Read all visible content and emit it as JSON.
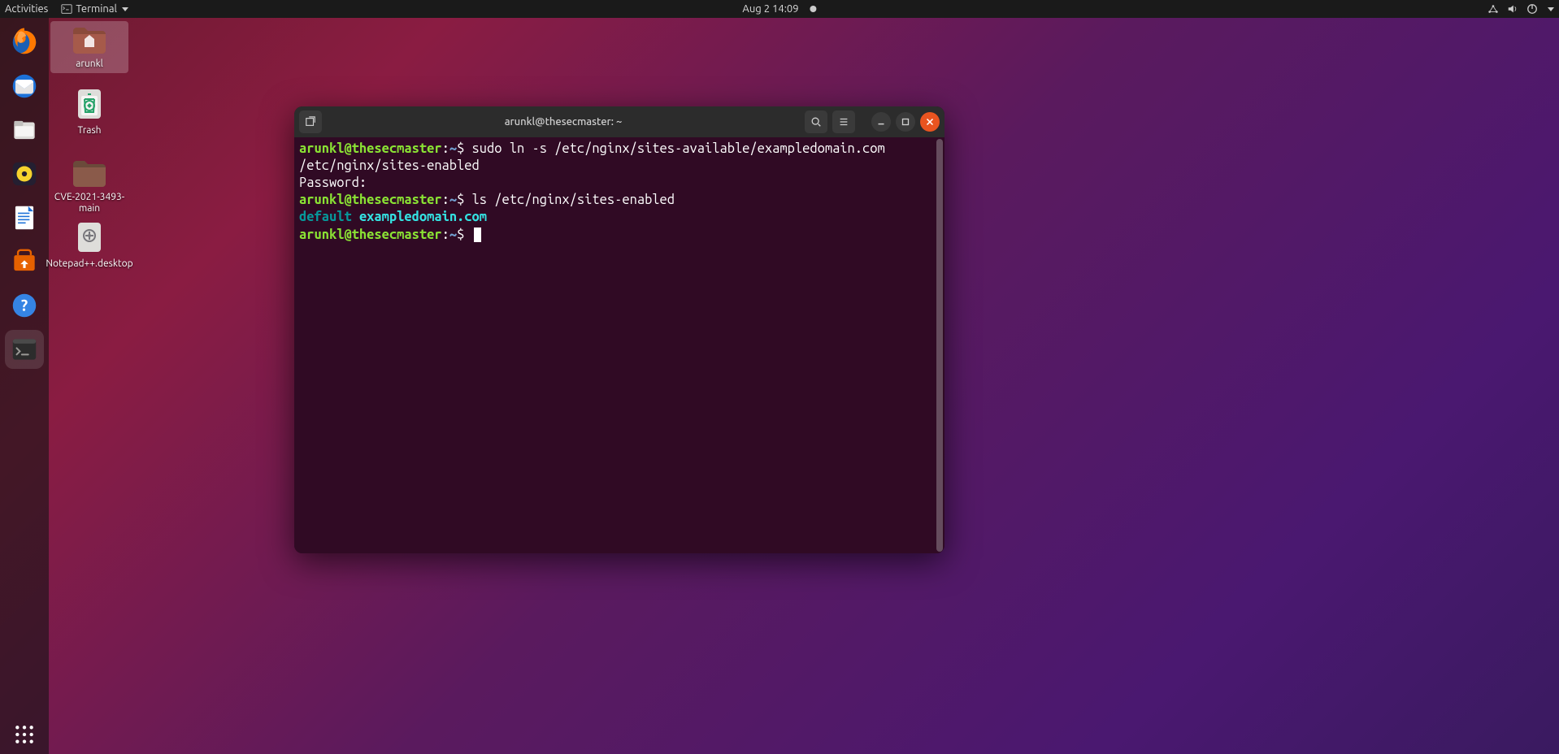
{
  "topbar": {
    "activities": "Activities",
    "app_label": "Terminal",
    "datetime": "Aug 2  14:09"
  },
  "desktop": {
    "icons": [
      {
        "label": "arunkl",
        "type": "home"
      },
      {
        "label": "Trash",
        "type": "trash"
      },
      {
        "label": "CVE-2021-3493-main",
        "type": "folder"
      },
      {
        "label": "Notepad++.desktop",
        "type": "file"
      }
    ]
  },
  "dock": {
    "items": [
      "firefox",
      "thunderbird",
      "files",
      "rhythmbox",
      "libreoffice-writer",
      "ubuntu-software",
      "help",
      "terminal"
    ]
  },
  "terminal": {
    "title": "arunkl@thesecmaster: ~",
    "lines": [
      {
        "type": "prompt",
        "user": "arunkl@thesecmaster",
        "path": "~",
        "cmd": "sudo ln -s /etc/nginx/sites-available/exampledomain.com /etc/nginx/sites-enabled"
      },
      {
        "type": "output",
        "text": "Password:"
      },
      {
        "type": "prompt",
        "user": "arunkl@thesecmaster",
        "path": "~",
        "cmd": "ls /etc/nginx/sites-enabled"
      },
      {
        "type": "ls-output",
        "default": "default",
        "link": "exampledomain.com"
      },
      {
        "type": "prompt",
        "user": "arunkl@thesecmaster",
        "path": "~",
        "cmd": "",
        "cursor": true
      }
    ]
  }
}
